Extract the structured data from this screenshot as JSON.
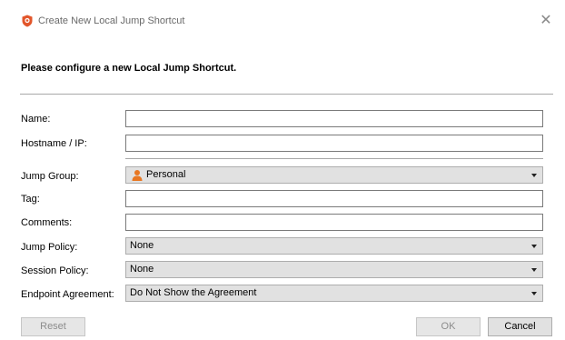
{
  "window": {
    "title": "Create New Local Jump Shortcut",
    "close_glyph": "✕"
  },
  "header": {
    "text": "Please configure a new Local Jump Shortcut."
  },
  "form": {
    "name": {
      "label": "Name:",
      "value": ""
    },
    "hostname": {
      "label": "Hostname / IP:",
      "value": ""
    },
    "jump_group": {
      "label": "Jump Group:",
      "selected": "Personal",
      "icon": "person-icon"
    },
    "tag": {
      "label": "Tag:",
      "value": ""
    },
    "comments": {
      "label": "Comments:",
      "value": ""
    },
    "jump_policy": {
      "label": "Jump Policy:",
      "selected": "None"
    },
    "session_policy": {
      "label": "Session Policy:",
      "selected": "None"
    },
    "endpoint_agreement": {
      "label": "Endpoint Agreement:",
      "selected": "Do Not Show the Agreement"
    }
  },
  "buttons": {
    "reset": "Reset",
    "ok": "OK",
    "cancel": "Cancel"
  },
  "colors": {
    "app_icon": "#e2562b",
    "person_icon": "#e87722"
  }
}
